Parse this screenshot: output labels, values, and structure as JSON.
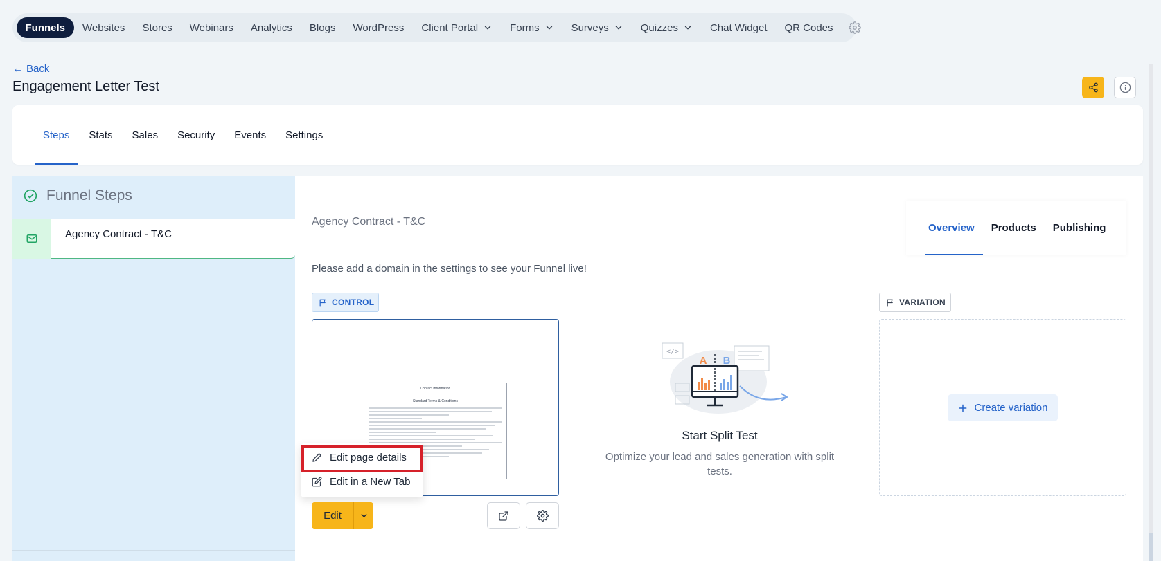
{
  "nav": {
    "items": [
      {
        "label": "Funnels"
      },
      {
        "label": "Websites"
      },
      {
        "label": "Stores"
      },
      {
        "label": "Webinars"
      },
      {
        "label": "Analytics"
      },
      {
        "label": "Blogs"
      },
      {
        "label": "WordPress"
      },
      {
        "label": "Client Portal"
      },
      {
        "label": "Forms"
      },
      {
        "label": "Surveys"
      },
      {
        "label": "Quizzes"
      },
      {
        "label": "Chat Widget"
      },
      {
        "label": "QR Codes"
      }
    ],
    "active": "Funnels"
  },
  "header": {
    "back_label": "Back",
    "title": "Engagement Letter Test"
  },
  "tabs": [
    {
      "label": "Steps"
    },
    {
      "label": "Stats"
    },
    {
      "label": "Sales"
    },
    {
      "label": "Security"
    },
    {
      "label": "Events"
    },
    {
      "label": "Settings"
    }
  ],
  "sidebar": {
    "title": "Funnel Steps",
    "steps": [
      {
        "label": "Agency Contract - T&C"
      }
    ]
  },
  "main": {
    "step_name": "Agency Contract - T&C",
    "sub_tabs": [
      {
        "label": "Overview"
      },
      {
        "label": "Products"
      },
      {
        "label": "Publishing"
      }
    ],
    "notice": "Please add a domain in the settings to see your Funnel live!",
    "control_label": "CONTROL",
    "variation_label": "VARIATION",
    "preview": {
      "title": "Contact Information",
      "subtitle": "Standard Terms & Conditions"
    },
    "edit_label": "Edit",
    "menu": {
      "edit_details": "Edit page details",
      "edit_new_tab": "Edit in a New Tab"
    },
    "split_test": {
      "title": "Start Split Test",
      "description": "Optimize your lead and sales generation with split tests."
    },
    "create_variation_label": "Create variation"
  },
  "colors": {
    "accent": "#2563c9",
    "nav_active_bg": "#0f1e3e",
    "primary_button": "#f7b51a",
    "highlight_border": "#d6212a",
    "success": "#22a565"
  }
}
